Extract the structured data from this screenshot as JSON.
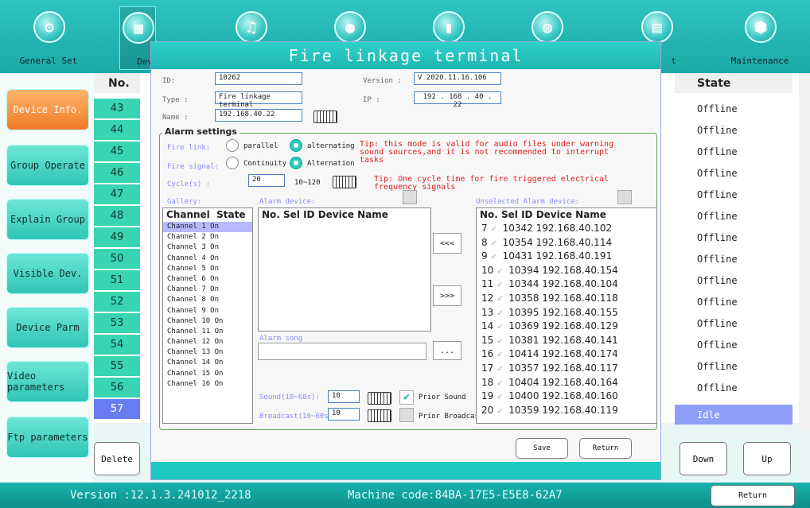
{
  "top_nav": [
    {
      "label": "General Set",
      "icon": "gear-icon"
    },
    {
      "label": "Dev",
      "icon": "grid-icon"
    },
    {
      "label": "",
      "icon": "music-icon"
    },
    {
      "label": "",
      "icon": "user-icon"
    },
    {
      "label": "",
      "icon": "chart-icon"
    },
    {
      "label": "",
      "icon": "globe-icon"
    },
    {
      "label": "t",
      "icon": "calendar-icon"
    },
    {
      "label": "Maintenance",
      "icon": "shield-icon"
    }
  ],
  "sidebar": [
    "Device Info.",
    "Group Operate",
    "Explain Group",
    "Visible Dev.",
    "Device Parm",
    "Video parameters",
    "Ftp parameters"
  ],
  "table": {
    "no_header": "No.",
    "state_header": "State",
    "numbers": [
      "43",
      "44",
      "45",
      "46",
      "47",
      "48",
      "49",
      "50",
      "51",
      "52",
      "53",
      "54",
      "55",
      "56",
      "57"
    ],
    "states": [
      "Offline",
      "Offline",
      "Offline",
      "Offline",
      "Offline",
      "Offline",
      "Offline",
      "Offline",
      "Offline",
      "Offline",
      "Offline",
      "Offline",
      "Offline",
      "Offline",
      "Idle"
    ]
  },
  "buttons": {
    "delete": "Delete",
    "down": "Down",
    "up": "Up",
    "return": "Return"
  },
  "status": {
    "version": "Version :12.1.3.241012_2218",
    "machine": "Machine code:84BA-17E5-E5E8-62A7"
  },
  "dialog": {
    "title": "Fire linkage terminal",
    "id_label": "ID:",
    "id_value": "10262",
    "version_label": "Version  :",
    "version_value": "V 2020.11.16.106",
    "type_label": "Type :",
    "type_value": "Fire linkage terminal",
    "ip_label": "IP   :",
    "ip_value": "192 . 168 . 40 . 22",
    "name_label": "Name :",
    "name_value": "192.168.40.22",
    "alarm_title": "Alarm settings",
    "fire_link_label": "Fire link:",
    "parallel": "parallel",
    "alternating": "alternating",
    "tip1": "Tip: this mode is valid for audio files under warning sound sources,and it is not recommended to interrupt tasks",
    "fire_signal_label": "Fire signal:",
    "continuity": "Continuity",
    "alternation": "Alternation",
    "cycle_label": "Cycle(s) :",
    "cycle_value": "20",
    "cycle_range": "10~120",
    "tip2": "Tip: One cycle time for fire triggered electrical frequency signals",
    "gallery_label": "Gallery:",
    "alarm_device_label": "Alarm device:",
    "unselected_label": "Unselected Alarm device:",
    "ch_header_channel": "Channel",
    "ch_header_state": "State",
    "channels": [
      "Channel 1  On",
      "Channel 2  On",
      "Channel 3  On",
      "Channel 4  On",
      "Channel 5  On",
      "Channel 6  On",
      "Channel 7  On",
      "Channel 8  On",
      "Channel 9  On",
      "Channel 10 On",
      "Channel 11 On",
      "Channel 12 On",
      "Channel 13 On",
      "Channel 14 On",
      "Channel 15 On",
      "Channel 16 On"
    ],
    "ad_header": "No. Sel    ID     Device Name",
    "move_left": "<<<",
    "move_right": ">>>",
    "alarm_song_label": "Alarm song",
    "browse": "...",
    "sound_label": "Sound(10~60s):",
    "sound_value": "10",
    "prior_sound": "Prior Sound",
    "broadcast_label": "Broadcast(10~60s)",
    "broadcast_value": "10",
    "prior_broadcast": "Prior Broadcast",
    "ud_header": "No. Sel    ID     Device Name",
    "unselected": [
      {
        "no": "7",
        "id": "10342",
        "ip": "192.168.40.102"
      },
      {
        "no": "8",
        "id": "10354",
        "ip": "192.168.40.114"
      },
      {
        "no": "9",
        "id": "10431",
        "ip": "192.168.40.191"
      },
      {
        "no": "10",
        "id": "10394",
        "ip": "192.168.40.154"
      },
      {
        "no": "11",
        "id": "10344",
        "ip": "192.168.40.104"
      },
      {
        "no": "12",
        "id": "10358",
        "ip": "192.168.40.118"
      },
      {
        "no": "13",
        "id": "10395",
        "ip": "192.168.40.155"
      },
      {
        "no": "14",
        "id": "10369",
        "ip": "192.168.40.129"
      },
      {
        "no": "15",
        "id": "10381",
        "ip": "192.168.40.141"
      },
      {
        "no": "16",
        "id": "10414",
        "ip": "192.168.40.174"
      },
      {
        "no": "17",
        "id": "10357",
        "ip": "192.168.40.117"
      },
      {
        "no": "18",
        "id": "10404",
        "ip": "192.168.40.164"
      },
      {
        "no": "19",
        "id": "10400",
        "ip": "192.168.40.160"
      },
      {
        "no": "20",
        "id": "10359",
        "ip": "192.168.40.119"
      }
    ],
    "save": "Save",
    "return": "Return"
  }
}
